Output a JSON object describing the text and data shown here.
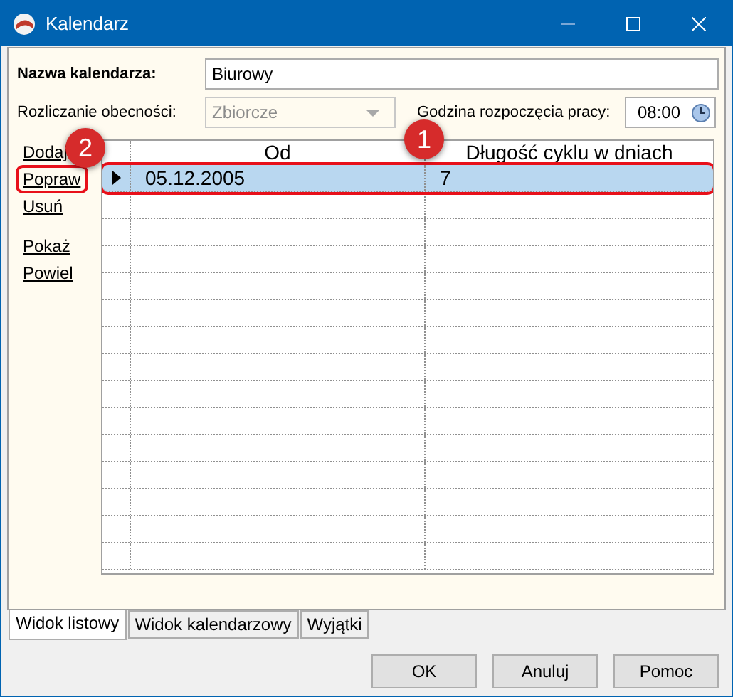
{
  "window": {
    "title": "Kalendarz"
  },
  "fields": {
    "name_label": "Nazwa kalendarza:",
    "name_value": "Biurowy",
    "mode_label": "Rozliczanie obecności:",
    "mode_value": "Zbiorcze",
    "mode_disabled": true,
    "start_label": "Godzina rozpoczęcia pracy:",
    "start_value": "08:00"
  },
  "actions": [
    {
      "label": "Dodaj",
      "highlighted": false
    },
    {
      "label": "Popraw",
      "highlighted": true
    },
    {
      "label": "Usuń",
      "highlighted": false
    },
    {
      "label": "Pokaż",
      "highlighted": false
    },
    {
      "label": "Powiel",
      "highlighted": false
    }
  ],
  "table": {
    "columns": [
      "Od",
      "Długość cyklu w dniach"
    ],
    "rows": [
      {
        "cells": [
          "05.12.2005",
          "7"
        ],
        "selected": true,
        "highlighted": true
      }
    ]
  },
  "badges": [
    {
      "number": "2"
    },
    {
      "number": "1"
    }
  ],
  "tabs": [
    {
      "label": "Widok listowy",
      "selected": true
    },
    {
      "label": "Widok kalendarzowy",
      "selected": false
    },
    {
      "label": "Wyjątki",
      "selected": false
    }
  ],
  "buttons": [
    "OK",
    "Anuluj",
    "Pomoc"
  ]
}
